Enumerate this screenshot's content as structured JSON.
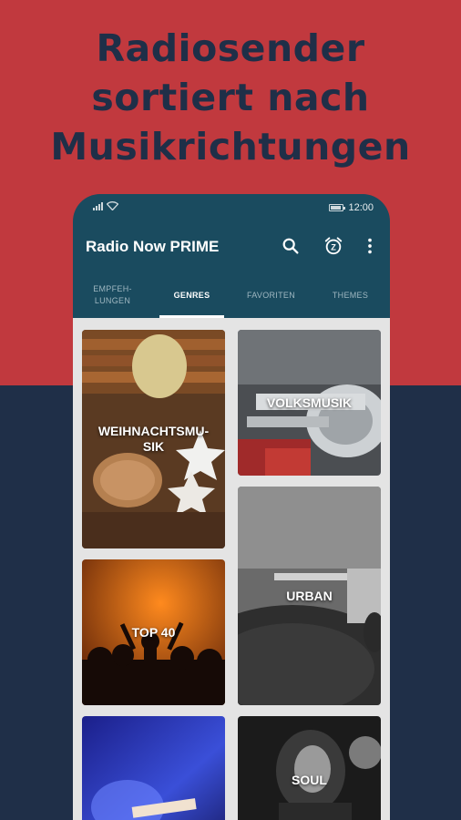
{
  "headline": {
    "line1": "Radiosender",
    "line2": "sortiert nach",
    "line3": "Musikrichtungen"
  },
  "colors": {
    "red": "#c1393e",
    "navy": "#1f2f48",
    "appbar": "#1a4b5f"
  },
  "statusbar": {
    "time": "12:00"
  },
  "appbar": {
    "title": "Radio Now PRIME",
    "icons": [
      "search-icon",
      "alarm-timer-icon",
      "more-vert-icon"
    ],
    "alarm_digit": "Z"
  },
  "tabs": [
    {
      "label": "EMPFEH-\nLUNGEN",
      "active": false
    },
    {
      "label": "GENRES",
      "active": true
    },
    {
      "label": "FAVORITEN",
      "active": false
    },
    {
      "label": "THEMES",
      "active": false
    }
  ],
  "genres": {
    "weihnachtsmusik": "WEIHNACHTSMU-SIK",
    "volksmusik": "VOLKSMUSIK",
    "urban": "URBAN",
    "top40": "TOP 40",
    "soul": "SOUL"
  }
}
